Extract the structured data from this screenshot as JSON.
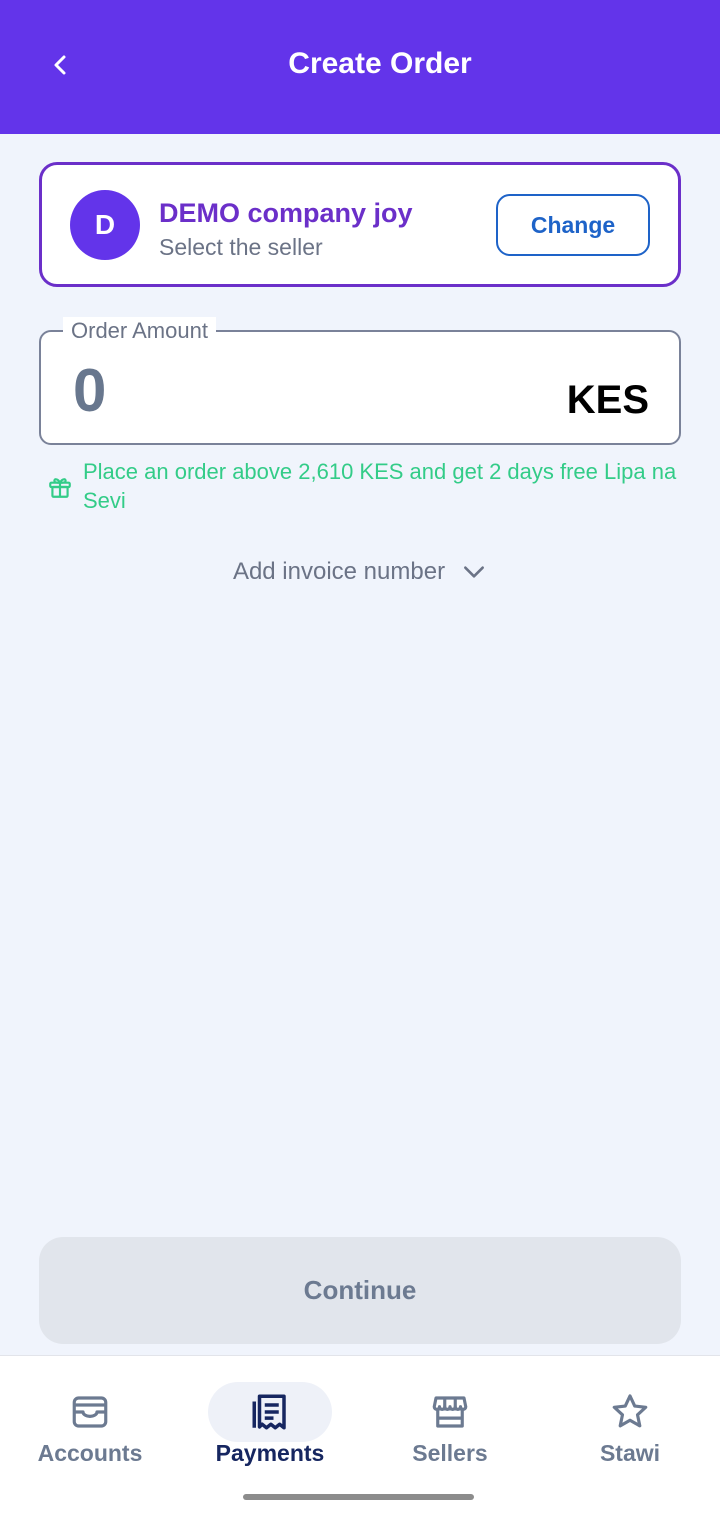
{
  "header": {
    "title": "Create Order",
    "back_icon": "chevron-left-icon"
  },
  "seller": {
    "avatar_letter": "D",
    "name": "DEMO company joy",
    "subtitle": "Select the seller",
    "change_label": "Change"
  },
  "order_amount": {
    "label": "Order Amount",
    "value": "0",
    "currency": "KES"
  },
  "promo": {
    "icon": "gift-icon",
    "text": "Place an order above 2,610 KES and get 2 days free Lipa na Sevi"
  },
  "invoice": {
    "label": "Add invoice number",
    "icon": "chevron-down-icon"
  },
  "continue_label": "Continue",
  "nav": {
    "items": [
      {
        "label": "Accounts",
        "icon": "wallet-icon",
        "active": false
      },
      {
        "label": "Payments",
        "icon": "receipt-icon",
        "active": true
      },
      {
        "label": "Sellers",
        "icon": "store-icon",
        "active": false
      },
      {
        "label": "Stawi",
        "icon": "star-icon",
        "active": false
      }
    ]
  },
  "colors": {
    "brand": "#6334ea",
    "seller_accent": "#6b2fc9",
    "link_blue": "#1e63c8",
    "promo_green": "#33cc88",
    "nav_active": "#162660"
  }
}
